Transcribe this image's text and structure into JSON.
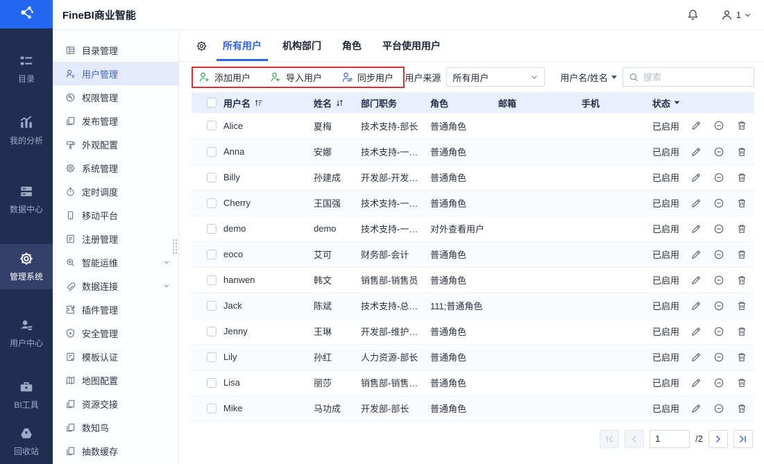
{
  "app": {
    "title": "FineBI商业智能"
  },
  "colors": {
    "sidebar_bg": "#202e52",
    "logo_blue": "#2468f2",
    "accent_blue": "#2d62e8",
    "green_icon": "#2aaf4e",
    "annotation_red": "#dc2f2f",
    "table_header_bg": "#e9effd",
    "selected_menu_bg": "#e4eafa"
  },
  "topbar": {
    "user_label": "1"
  },
  "primary_sidebar": {
    "items": [
      {
        "key": "catalog",
        "label": "目录",
        "icon": "catalog-icon",
        "active": false
      },
      {
        "key": "my-analysis",
        "label": "我的分析",
        "icon": "analysis-icon",
        "active": false
      },
      {
        "key": "data-center",
        "label": "数据中心",
        "icon": "data-center-icon",
        "active": false
      },
      {
        "key": "admin-system",
        "label": "管理系统",
        "icon": "admin-gear-icon",
        "active": true
      },
      {
        "key": "user-center",
        "label": "用户中心",
        "icon": "user-center-icon",
        "active": false
      },
      {
        "key": "bi-tools",
        "label": "BI工具",
        "icon": "bi-tools-icon",
        "active": false
      },
      {
        "key": "recycle-bin",
        "label": "回收站",
        "icon": "recycle-bin-icon",
        "active": false
      }
    ]
  },
  "secondary_sidebar": {
    "items": [
      {
        "key": "catalog-mgmt",
        "label": "目录管理",
        "icon": "catalog-list-icon",
        "active": false,
        "expandable": false
      },
      {
        "key": "user-mgmt",
        "label": "用户管理",
        "icon": "user-icon",
        "active": true,
        "expandable": false
      },
      {
        "key": "permission-mgmt",
        "label": "权限管理",
        "icon": "permission-icon",
        "active": false,
        "expandable": false
      },
      {
        "key": "publish-mgmt",
        "label": "发布管理",
        "icon": "copy-icon",
        "active": false,
        "expandable": false
      },
      {
        "key": "appearance-config",
        "label": "外观配置",
        "icon": "appearance-icon",
        "active": false,
        "expandable": false
      },
      {
        "key": "system-mgmt",
        "label": "系统管理",
        "icon": "gear-icon",
        "active": false,
        "expandable": false
      },
      {
        "key": "schedule",
        "label": "定时调度",
        "icon": "timer-icon",
        "active": false,
        "expandable": false
      },
      {
        "key": "mobile-platform",
        "label": "移动平台",
        "icon": "mobile-icon",
        "active": false,
        "expandable": false
      },
      {
        "key": "register-mgmt",
        "label": "注册管理",
        "icon": "register-icon",
        "active": false,
        "expandable": false
      },
      {
        "key": "intelligent-ops",
        "label": "智能运维",
        "icon": "ops-search-icon",
        "active": false,
        "expandable": true
      },
      {
        "key": "data-connection",
        "label": "数据连接",
        "icon": "paperclip-icon",
        "active": false,
        "expandable": true
      },
      {
        "key": "plugin-mgmt",
        "label": "插件管理",
        "icon": "plugin-icon",
        "active": false,
        "expandable": false
      },
      {
        "key": "security-mgmt",
        "label": "安全管理",
        "icon": "shield-icon",
        "active": false,
        "expandable": false
      },
      {
        "key": "template-cert",
        "label": "模板认证",
        "icon": "template-icon",
        "active": false,
        "expandable": false
      },
      {
        "key": "map-config",
        "label": "地图配置",
        "icon": "map-icon",
        "active": false,
        "expandable": false
      },
      {
        "key": "resource-handover",
        "label": "资源交接",
        "icon": "copy-icon",
        "active": false,
        "expandable": false
      },
      {
        "key": "shuzhiniao",
        "label": "数知鸟",
        "icon": "copy-icon",
        "active": false,
        "expandable": false
      },
      {
        "key": "extract-cache",
        "label": "抽数缓存",
        "icon": "copy-icon",
        "active": false,
        "expandable": false
      }
    ]
  },
  "tabs": [
    {
      "key": "all-users",
      "label": "所有用户",
      "active": true
    },
    {
      "key": "org-dept",
      "label": "机构部门",
      "active": false
    },
    {
      "key": "role",
      "label": "角色",
      "active": false
    },
    {
      "key": "platform-users",
      "label": "平台使用用户",
      "active": false
    }
  ],
  "toolbar": {
    "buttons": [
      {
        "key": "add-user",
        "label": "添加用户",
        "icon": "user-add-icon",
        "icon_color": "#2aaf4e"
      },
      {
        "key": "import-user",
        "label": "导入用户",
        "icon": "user-import-icon",
        "icon_color": "#2aaf4e"
      },
      {
        "key": "sync-user",
        "label": "同步用户",
        "icon": "user-sync-icon",
        "icon_color": "#2d62e8"
      }
    ],
    "user_source_label": "用户来源",
    "user_source_value": "所有用户",
    "search_field_label": "用户名/姓名",
    "search_placeholder": "搜索"
  },
  "annotation": {
    "type": "highlight-box",
    "color": "#dc2f2f"
  },
  "table": {
    "columns": [
      {
        "key": "username",
        "label": "用户名",
        "sort": "asc"
      },
      {
        "key": "name",
        "label": "姓名",
        "sort": "both"
      },
      {
        "key": "dept",
        "label": "部门职务"
      },
      {
        "key": "role",
        "label": "角色"
      },
      {
        "key": "email",
        "label": "邮箱"
      },
      {
        "key": "phone",
        "label": "手机"
      },
      {
        "key": "status",
        "label": "状态",
        "filter": true
      }
    ],
    "rows": [
      {
        "username": "Alice",
        "name": "夏梅",
        "dept": "技术支持-部长",
        "role": "普通角色",
        "email": "",
        "phone": "",
        "status": "已启用"
      },
      {
        "username": "Anna",
        "name": "安娜",
        "dept": "技术支持-一线...",
        "role": "普通角色",
        "email": "",
        "phone": "",
        "status": "已启用"
      },
      {
        "username": "Billy",
        "name": "孙建成",
        "dept": "开发部-开发工...",
        "role": "普通角色",
        "email": "",
        "phone": "",
        "status": "已启用"
      },
      {
        "username": "Cherry",
        "name": "王国强",
        "dept": "技术支持-一线...",
        "role": "普通角色",
        "email": "",
        "phone": "",
        "status": "已启用"
      },
      {
        "username": "demo",
        "name": "demo",
        "dept": "技术支持-一线...",
        "role": "对外查看用户",
        "email": "",
        "phone": "",
        "status": "已启用"
      },
      {
        "username": "eoco",
        "name": "艾可",
        "dept": "财务部-会计",
        "role": "普通角色",
        "email": "",
        "phone": "",
        "status": "已启用"
      },
      {
        "username": "hanwen",
        "name": "韩文",
        "dept": "销售部-销售员",
        "role": "普通角色",
        "email": "",
        "phone": "",
        "status": "已启用"
      },
      {
        "username": "Jack",
        "name": "陈斌",
        "dept": "技术支持-总调度",
        "role": "111;普通角色",
        "email": "",
        "phone": "",
        "status": "已启用"
      },
      {
        "username": "Jenny",
        "name": "王琳",
        "dept": "开发部-维护工...",
        "role": "普通角色",
        "email": "",
        "phone": "",
        "status": "已启用"
      },
      {
        "username": "Lily",
        "name": "孙红",
        "dept": "人力资源-部长",
        "role": "普通角色",
        "email": "",
        "phone": "",
        "status": "已启用"
      },
      {
        "username": "Lisa",
        "name": "丽莎",
        "dept": "销售部-销售主管",
        "role": "普通角色",
        "email": "",
        "phone": "",
        "status": "已启用"
      },
      {
        "username": "Mike",
        "name": "马功成",
        "dept": "开发部-部长",
        "role": "普通角色",
        "email": "",
        "phone": "",
        "status": "已启用"
      }
    ],
    "row_actions": [
      {
        "key": "edit",
        "icon": "edit-icon"
      },
      {
        "key": "disable",
        "icon": "minus-circle-icon"
      },
      {
        "key": "delete",
        "icon": "trash-icon"
      }
    ]
  },
  "pagination": {
    "current_page": "1",
    "page_total_label": "/2"
  }
}
